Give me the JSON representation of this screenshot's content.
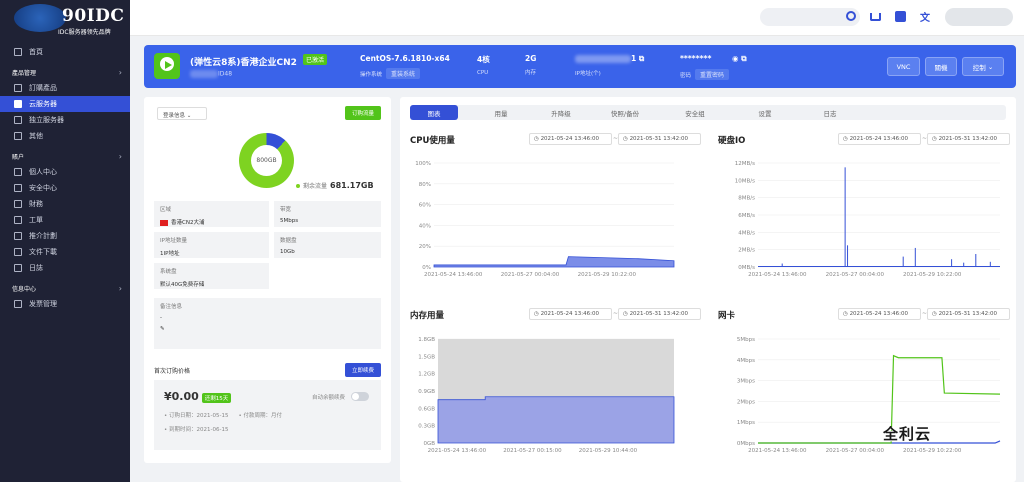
{
  "brand": {
    "name": "90IDC",
    "tagline": "IDC服务器领先品牌"
  },
  "sidebar": {
    "items": [
      {
        "label": "首頁",
        "icon": "home-icon"
      },
      {
        "section": "產品管理"
      },
      {
        "label": "訂購產品",
        "icon": "cart-icon"
      },
      {
        "label": "云服务器",
        "icon": "grid-icon",
        "active": true
      },
      {
        "label": "独立服务器",
        "icon": "grid-icon"
      },
      {
        "label": "其他",
        "icon": "grid-icon"
      },
      {
        "section": "賬户"
      },
      {
        "label": "個人中心",
        "icon": "user-icon"
      },
      {
        "label": "安全中心",
        "icon": "shield-icon"
      },
      {
        "label": "財務",
        "icon": "money-icon"
      },
      {
        "label": "工單",
        "icon": "ticket-icon"
      },
      {
        "label": "推介計劃",
        "icon": "chart-icon"
      },
      {
        "label": "文件下載",
        "icon": "download-icon"
      },
      {
        "label": "日誌",
        "icon": "log-icon"
      },
      {
        "section": "信息中心"
      },
      {
        "label": "发票管理",
        "icon": "invoice-icon"
      }
    ]
  },
  "banner": {
    "title": "(弹性云8系)香港企业CN2",
    "status": "已激活",
    "subtitle": "ID48",
    "os": "CentOS-7.6.1810-x64",
    "os_label": "操作系统",
    "reinstall": "重装系统",
    "cpu": "4核",
    "cpu_label": "CPU",
    "mem": "2G",
    "mem_label": "内存",
    "ip_suffix": "1",
    "ip_label": "IP地址(个)",
    "password": "********",
    "password_label": "密码",
    "reset_pwd": "重置密码",
    "vnc": "VNC",
    "shutdown": "關機",
    "control": "控制"
  },
  "left": {
    "login_select": "登录信息",
    "order_traffic": "订购流量",
    "donut_center": "800GB",
    "remain_label": "剩余流量",
    "remain_value": "681.17GB",
    "region_label": "区域",
    "region_value": "香港CN2大浦",
    "bandwidth_label": "带宽",
    "bandwidth_value": "5Mbps",
    "ipcount_label": "IP地址数量",
    "ipcount_value": "1IP地址",
    "datadisk_label": "数据盘",
    "datadisk_value": "10Gb",
    "sysdisk_label": "系统盘",
    "sysdisk_value": "默认40G免费存储",
    "note_label": "备注信息",
    "note_value": "-",
    "note_edit": "✎",
    "price_label": "首次订购价格",
    "renew": "立即续费",
    "price": "¥0.00",
    "price_badge": "还剩15天",
    "autorenew": "自动余额续费",
    "order_date_label": "订购日期：",
    "order_date": "2021-05-15",
    "pay_label": "付款周期：",
    "pay": "月付",
    "expire_label": "到期时间：",
    "expire": "2021-06-15"
  },
  "tabs": [
    "图表",
    "用量",
    "升降级",
    "快照/备份",
    "安全组",
    "设置",
    "日志"
  ],
  "charts": {
    "cpu": {
      "title": "CPU使用量",
      "from": "2021-05-24 13:46:00",
      "to": "2021-05-31 13:42:00"
    },
    "disk": {
      "title": "硬盘IO",
      "from": "2021-05-24 13:46:00",
      "to": "2021-05-31 13:42:00"
    },
    "mem": {
      "title": "内存用量",
      "from": "2021-05-24 13:46:00",
      "to": "2021-05-31 13:42:00"
    },
    "net": {
      "title": "网卡",
      "from": "2021-05-24 13:46:00",
      "to": "2021-05-31 13:42:00"
    }
  },
  "chart_data": [
    {
      "type": "area",
      "title": "CPU使用量",
      "y_ticks": [
        "100%",
        "80%",
        "60%",
        "40%",
        "20%",
        "0%"
      ],
      "x_ticks": [
        "2021-05-24 13:46:00",
        "2021-05-27 00:04:00",
        "2021-05-29 10:22:00"
      ],
      "ylim": [
        0,
        100
      ],
      "x": [
        0,
        0.2,
        0.4,
        0.55,
        0.56,
        0.7,
        0.85,
        1.0
      ],
      "values": [
        2,
        2,
        2,
        2,
        10,
        9,
        8,
        6
      ]
    },
    {
      "type": "line",
      "title": "硬盘IO",
      "y_ticks": [
        "12MB/s",
        "10MB/s",
        "8MB/s",
        "6MB/s",
        "4MB/s",
        "2MB/s",
        "0MB/s"
      ],
      "x_ticks": [
        "2021-05-24 13:46:00",
        "2021-05-27 00:04:00",
        "2021-05-29 10:22:00"
      ],
      "ylim": [
        0,
        12
      ],
      "spikes": [
        [
          0.1,
          0.4
        ],
        [
          0.36,
          11.5
        ],
        [
          0.37,
          2.5
        ],
        [
          0.6,
          1.2
        ],
        [
          0.65,
          2.2
        ],
        [
          0.8,
          0.9
        ],
        [
          0.85,
          0.5
        ],
        [
          0.9,
          1.5
        ],
        [
          0.96,
          0.6
        ]
      ]
    },
    {
      "type": "area",
      "title": "内存用量",
      "y_ticks": [
        "1.8GB",
        "1.5GB",
        "1.2GB",
        "0.9GB",
        "0.6GB",
        "0.3GB",
        "0GB"
      ],
      "x_ticks": [
        "2021-05-24 13:46:00",
        "2021-05-27 00:15:00",
        "2021-05-29 10:44:00"
      ],
      "ylim": [
        0,
        1.8
      ],
      "total": 1.8,
      "x": [
        0,
        0.2,
        0.2,
        1.0
      ],
      "values": [
        0.75,
        0.75,
        0.8,
        0.8
      ]
    },
    {
      "type": "line",
      "title": "网卡",
      "y_ticks": [
        "5Mbps",
        "4Mbps",
        "3Mbps",
        "2Mbps",
        "1Mbps",
        "0Mbps"
      ],
      "x_ticks": [
        "2021-05-24 13:46:00",
        "2021-05-27 00:04:00",
        "2021-05-29 10:22:00"
      ],
      "ylim": [
        0,
        5
      ],
      "series": [
        {
          "name": "in",
          "color": "#3450d6",
          "x": [
            0,
            0.98,
            1.0
          ],
          "values": [
            0,
            0,
            0.1
          ]
        },
        {
          "name": "out",
          "color": "#52c41a",
          "x": [
            0,
            0.55,
            0.56,
            0.58,
            0.76,
            0.77,
            1.0
          ],
          "values": [
            0,
            0,
            4.2,
            4.1,
            4.1,
            2.4,
            2.35
          ]
        }
      ]
    }
  ],
  "watermark": "全利云"
}
